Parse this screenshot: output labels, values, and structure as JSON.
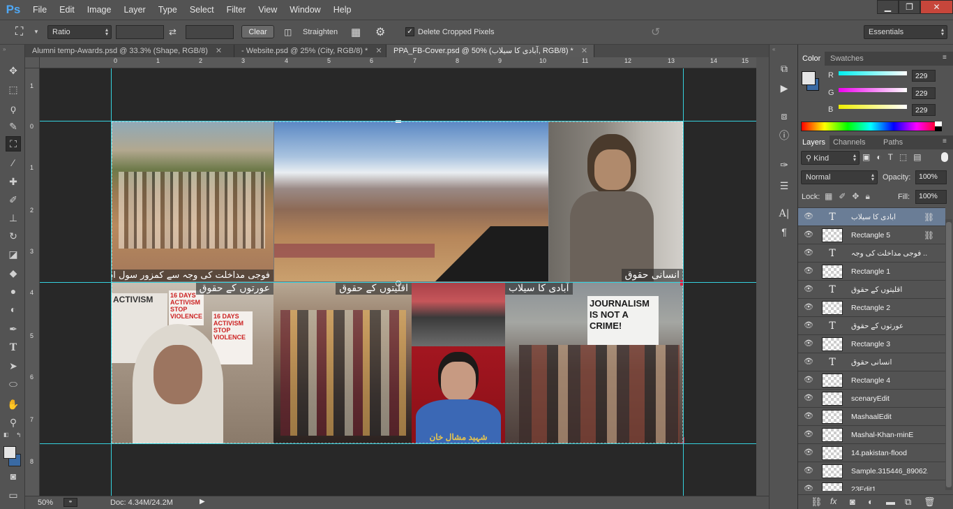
{
  "app": {
    "logo": "Ps"
  },
  "menu": [
    "File",
    "Edit",
    "Image",
    "Layer",
    "Type",
    "Select",
    "Filter",
    "View",
    "Window",
    "Help"
  ],
  "window_controls": {
    "minimize": "▁",
    "restore": "❐",
    "close": "✕"
  },
  "options": {
    "ratio_label": "Ratio",
    "clear_label": "Clear",
    "straighten_label": "Straighten",
    "delete_cropped_label": "Delete Cropped Pixels",
    "delete_cropped_checked": true,
    "workspace_label": "Essentials"
  },
  "tabs": [
    {
      "label": "Alumni temp-Awards.psd @ 33.3% (Shape, RGB/8)",
      "active": false
    },
    {
      "label": "- Website.psd @ 25% (City, RGB/8) *",
      "active": false
    },
    {
      "label": "PPA_FB-Cover.psd @ 50% (آبادی کا سیلاب, RGB/8) *",
      "active": true
    }
  ],
  "ruler": {
    "h_ticks": [
      "0",
      "1",
      "2",
      "3",
      "4",
      "5",
      "6",
      "7",
      "8",
      "9",
      "10",
      "11",
      "12",
      "13",
      "14",
      "15"
    ],
    "v_ticks": [
      "1",
      "0",
      "1",
      "2",
      "3",
      "4",
      "5",
      "6",
      "7",
      "8"
    ]
  },
  "canvas": {
    "captions": {
      "flood": "فوجی مداخلت کی وجہ سے کمزور سول ادارے",
      "child": "انسانی حقوق",
      "women": "عورتوں کے حقوق",
      "minorities": "اقلیتوں کے حقوق",
      "population": "آبادی کا سیلاب",
      "protest_sign_1": "ACTIVISM",
      "protest_sign_2": "16 DAYS ACTIVISM STOP VIOLENCE",
      "journalism_sign": "JOURNALISM IS NOT A CRIME!",
      "mashal_caption": "شہید مشال خان"
    }
  },
  "status": {
    "zoom": "50%",
    "doc": "Doc: 4.34M/24.2M"
  },
  "color_panel": {
    "tabs": [
      "Color",
      "Swatches"
    ],
    "r_label": "R",
    "g_label": "G",
    "b_label": "B",
    "r": "229",
    "g": "229",
    "b": "229"
  },
  "layers_panel": {
    "tabs": [
      "Layers",
      "Channels",
      "Paths"
    ],
    "kind_label": "Kind",
    "blend_mode": "Normal",
    "opacity_label": "Opacity:",
    "opacity": "100%",
    "lock_label": "Lock:",
    "fill_label": "Fill:",
    "fill": "100%",
    "layers": [
      {
        "name": "آبادی کا سیلاب",
        "type": "text",
        "selected": true,
        "linked": true
      },
      {
        "name": "Rectangle 5",
        "type": "shape",
        "selected": false,
        "linked": true
      },
      {
        "name": "فوجی مداخلت کی وجہ ...",
        "type": "text",
        "selected": false,
        "linked": false
      },
      {
        "name": "Rectangle 1",
        "type": "shape",
        "selected": false,
        "linked": false
      },
      {
        "name": "اقلیتوں کے حقوق",
        "type": "text",
        "selected": false,
        "linked": false
      },
      {
        "name": "Rectangle 2",
        "type": "shape",
        "selected": false,
        "linked": false
      },
      {
        "name": "عورتوں کے حقوق",
        "type": "text",
        "selected": false,
        "linked": false
      },
      {
        "name": "Rectangle 3",
        "type": "shape",
        "selected": false,
        "linked": false
      },
      {
        "name": "انسانی حقوق",
        "type": "text",
        "selected": false,
        "linked": false
      },
      {
        "name": "Rectangle 4",
        "type": "shape",
        "selected": false,
        "linked": false
      },
      {
        "name": "scenaryEdit",
        "type": "image",
        "selected": false,
        "linked": false
      },
      {
        "name": "MashaalEdit",
        "type": "image",
        "selected": false,
        "linked": false
      },
      {
        "name": "Mashal-Khan-minE",
        "type": "image",
        "selected": false,
        "linked": false
      },
      {
        "name": "14.pakistan-flood",
        "type": "image",
        "selected": false,
        "linked": false
      },
      {
        "name": "Sample.315446_89062...",
        "type": "image",
        "selected": false,
        "linked": false
      },
      {
        "name": "23Edit1",
        "type": "image",
        "selected": false,
        "linked": false
      }
    ]
  }
}
